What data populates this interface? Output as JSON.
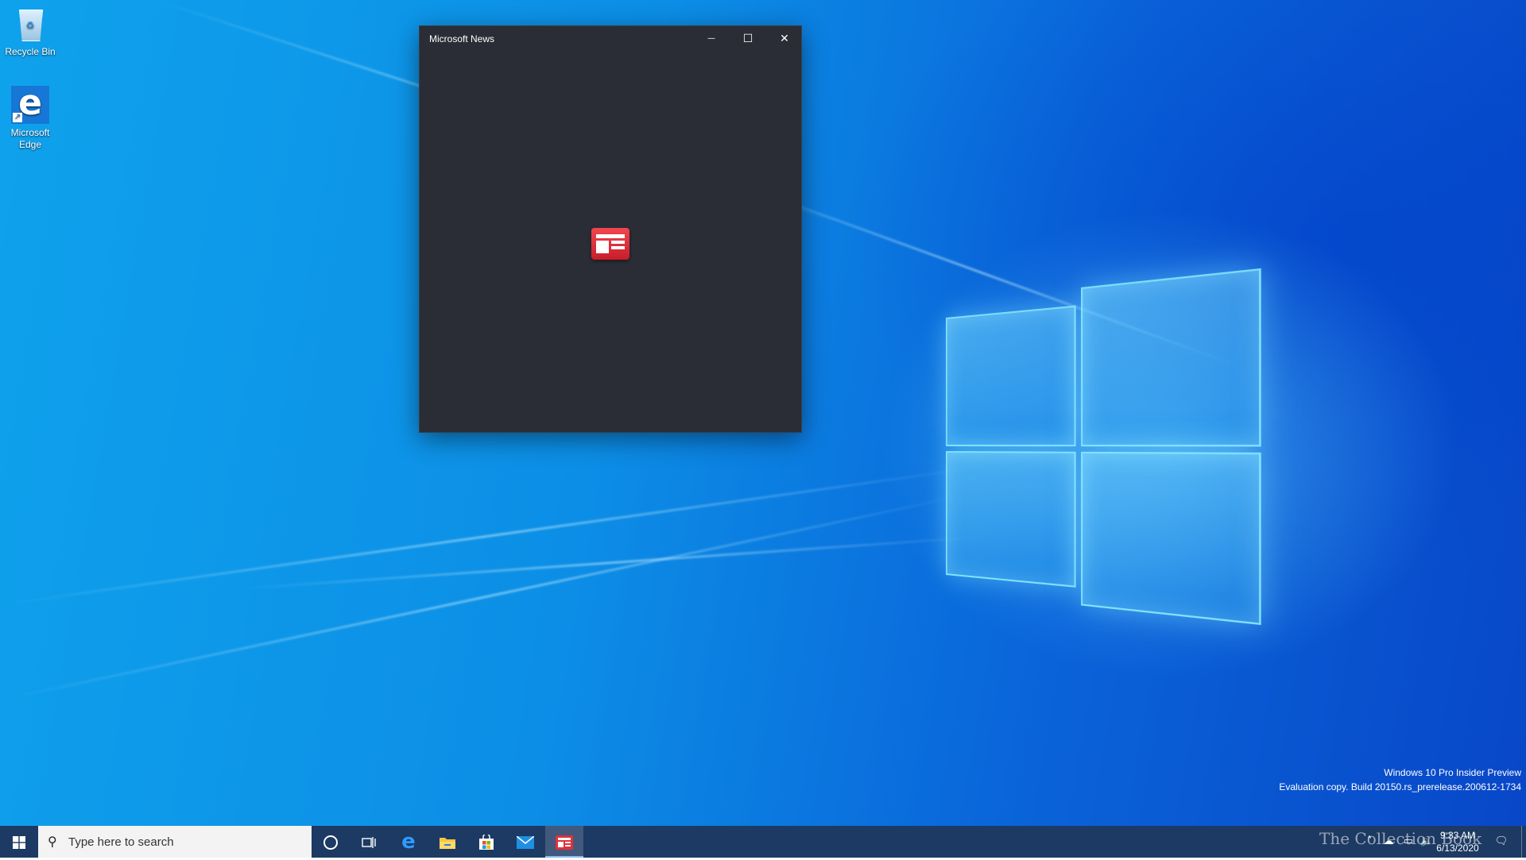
{
  "desktop": {
    "icons": [
      {
        "label": "Recycle Bin",
        "icon": "recycle-bin-icon"
      },
      {
        "label": "Microsoft Edge",
        "icon": "edge-icon"
      }
    ]
  },
  "window": {
    "title": "Microsoft News",
    "minimize_glyph": "—",
    "maximize_glyph": "☐",
    "close_glyph": "✕",
    "splash_icon": "news-app-icon",
    "background": "#2a2d35",
    "accent": "#e0313b"
  },
  "watermark": {
    "line1": "Windows 10 Pro Insider Preview",
    "line2": "Evaluation copy. Build 20150.rs_prerelease.200612-1734",
    "brand": "The Collection Book"
  },
  "taskbar": {
    "search_placeholder": "Type here to search",
    "apps": [
      "start-icon",
      "cortana-icon",
      "task-view-icon",
      "edge-icon",
      "file-explorer-icon",
      "store-icon",
      "mail-icon",
      "news-icon"
    ],
    "time": "9:33 AM",
    "date": "6/13/2020",
    "color": "#1c3a63"
  }
}
